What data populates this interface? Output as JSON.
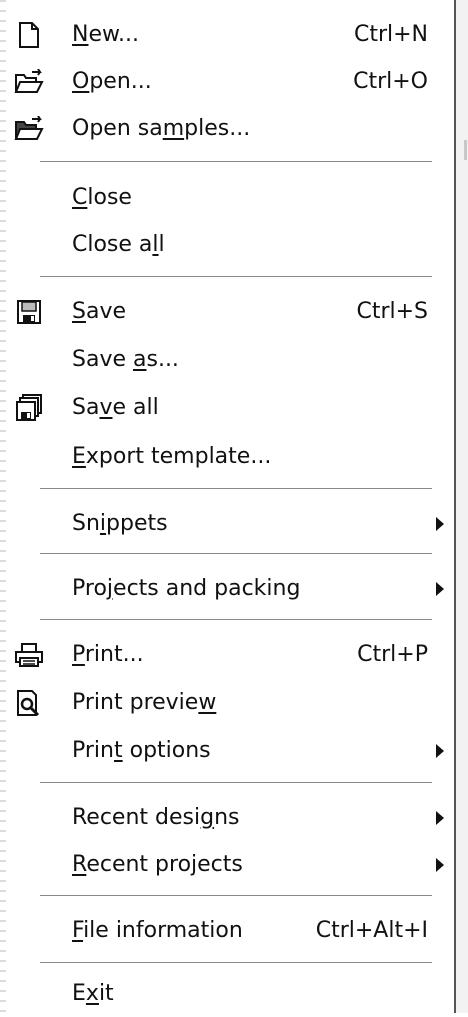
{
  "menu": {
    "items": [
      {
        "icon": "new-file-icon",
        "label": "New...",
        "mnemonic": "N",
        "shortcut": "Ctrl+N"
      },
      {
        "icon": "open-folder-icon",
        "label": "Open...",
        "mnemonic": "O",
        "shortcut": "Ctrl+O"
      },
      {
        "icon": "open-folder-icon",
        "label": "Open samples...",
        "mnemonic": "m",
        "shortcut": ""
      },
      {
        "icon": "",
        "label": "Close",
        "mnemonic": "C",
        "shortcut": ""
      },
      {
        "icon": "",
        "label": "Close all",
        "mnemonic": "l",
        "shortcut": ""
      },
      {
        "icon": "save-icon",
        "label": "Save",
        "mnemonic": "S",
        "shortcut": "Ctrl+S"
      },
      {
        "icon": "",
        "label": "Save as...",
        "mnemonic": "a",
        "shortcut": ""
      },
      {
        "icon": "save-all-icon",
        "label": "Save all",
        "mnemonic": "v",
        "shortcut": ""
      },
      {
        "icon": "",
        "label": "Export template...",
        "mnemonic": "E",
        "shortcut": ""
      },
      {
        "icon": "",
        "label": "Snippets",
        "mnemonic": "i",
        "shortcut": "",
        "submenu": true
      },
      {
        "icon": "",
        "label": "Projects and packing",
        "mnemonic": "j",
        "shortcut": "",
        "submenu": true
      },
      {
        "icon": "print-icon",
        "label": "Print...",
        "mnemonic": "P",
        "shortcut": "Ctrl+P"
      },
      {
        "icon": "print-preview-icon",
        "label": "Print preview",
        "mnemonic": "w",
        "shortcut": ""
      },
      {
        "icon": "",
        "label": "Print options",
        "mnemonic": "t",
        "shortcut": "",
        "submenu": true
      },
      {
        "icon": "",
        "label": "Recent designs",
        "mnemonic": "g",
        "shortcut": "",
        "submenu": true
      },
      {
        "icon": "",
        "label": "Recent projects",
        "mnemonic": "R",
        "shortcut": "",
        "submenu": true
      },
      {
        "icon": "",
        "label": "File information",
        "mnemonic": "F",
        "shortcut": "Ctrl+Alt+I"
      },
      {
        "icon": "",
        "label": "Exit",
        "mnemonic": "x",
        "shortcut": ""
      }
    ]
  }
}
